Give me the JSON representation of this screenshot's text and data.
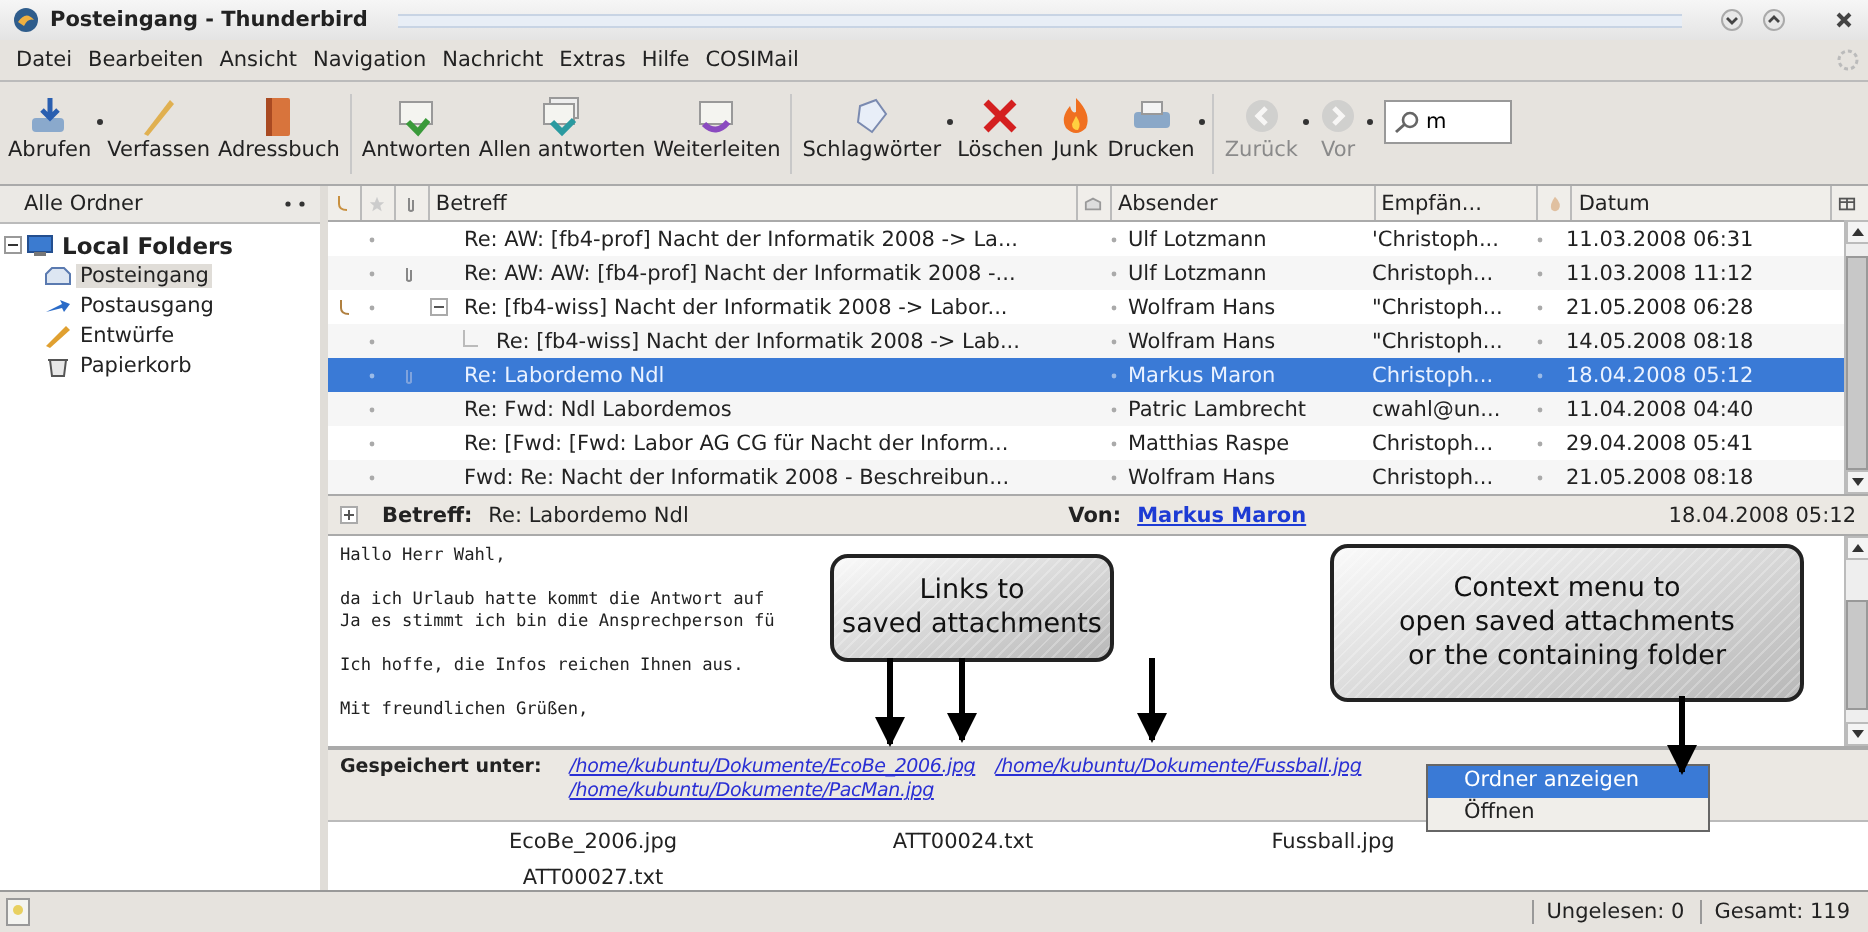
{
  "window": {
    "title": "Posteingang - Thunderbird"
  },
  "menu": [
    {
      "label": "Datei"
    },
    {
      "label": "Bearbeiten"
    },
    {
      "label": "Ansicht"
    },
    {
      "label": "Navigation"
    },
    {
      "label": "Nachricht"
    },
    {
      "label": "Extras"
    },
    {
      "label": "Hilfe"
    },
    {
      "label": "COSIMail"
    }
  ],
  "toolbar": {
    "groups": [
      [
        {
          "label": "Abrufen",
          "kind": "fetch",
          "disabled": false,
          "dropdown": true
        },
        {
          "label": "Verfassen",
          "kind": "compose",
          "disabled": false,
          "dropdown": false
        },
        {
          "label": "Adressbuch",
          "kind": "addressbook",
          "disabled": false,
          "dropdown": false
        }
      ],
      [
        {
          "label": "Antworten",
          "kind": "reply",
          "disabled": false,
          "dropdown": false
        },
        {
          "label": "Allen antworten",
          "kind": "replyall",
          "disabled": false,
          "dropdown": false
        },
        {
          "label": "Weiterleiten",
          "kind": "forward",
          "disabled": false,
          "dropdown": false
        }
      ],
      [
        {
          "label": "Schlagwörter",
          "kind": "tag",
          "disabled": false,
          "dropdown": true
        },
        {
          "label": "Löschen",
          "kind": "delete",
          "disabled": false,
          "dropdown": false
        },
        {
          "label": "Junk",
          "kind": "junk",
          "disabled": false,
          "dropdown": false
        },
        {
          "label": "Drucken",
          "kind": "print",
          "disabled": false,
          "dropdown": true
        }
      ],
      [
        {
          "label": "Zurück",
          "kind": "back",
          "disabled": true,
          "dropdown": true
        },
        {
          "label": "Vor",
          "kind": "next",
          "disabled": true,
          "dropdown": true
        }
      ]
    ],
    "search": {
      "value": "m"
    }
  },
  "folders": {
    "header": "Alle Ordner",
    "items": [
      {
        "label": "Local Folders",
        "kind": "account",
        "selected": false,
        "expanded": true,
        "children": [
          {
            "label": "Posteingang",
            "kind": "inbox",
            "selected": true
          },
          {
            "label": "Postausgang",
            "kind": "outbox",
            "selected": false
          },
          {
            "label": "Entwürfe",
            "kind": "drafts",
            "selected": false
          },
          {
            "label": "Papierkorb",
            "kind": "trash",
            "selected": false
          }
        ]
      }
    ]
  },
  "messages": {
    "columns": {
      "subject": "Betreff",
      "sender": "Absender",
      "recipient": "Empfän...",
      "date": "Datum"
    },
    "rows": [
      {
        "subject": "Re: AW: [fb4-prof] Nacht der Informatik 2008 -> La...",
        "sender": "Ulf Lotzmann",
        "recipient": "'Christoph...",
        "date": "11.03.2008 06:31",
        "attachment": false,
        "thread": false,
        "selected": false
      },
      {
        "subject": "Re: AW: AW: [fb4-prof] Nacht der Informatik 2008 -...",
        "sender": "Ulf Lotzmann",
        "recipient": "Christoph...",
        "date": "11.03.2008 11:12",
        "attachment": true,
        "thread": false,
        "selected": false
      },
      {
        "subject": "Re: [fb4-wiss] Nacht der Informatik 2008 -> Labor...",
        "sender": "Wolfram Hans",
        "recipient": "\"Christoph...",
        "date": "21.05.2008 06:28",
        "attachment": false,
        "thread": true,
        "selected": false,
        "expanded": true,
        "children": [
          {
            "subject": "Re: [fb4-wiss] Nacht der Informatik 2008 -> Lab...",
            "sender": "Wolfram Hans",
            "recipient": "\"Christoph...",
            "date": "14.05.2008 08:18",
            "attachment": false,
            "thread": false,
            "selected": false
          }
        ]
      },
      {
        "subject": "Re: Labordemo Ndl",
        "sender": "Markus Maron",
        "recipient": "Christoph...",
        "date": "18.04.2008 05:12",
        "attachment": true,
        "thread": false,
        "selected": true
      },
      {
        "subject": "Re: Fwd: Ndl Labordemos",
        "sender": "Patric Lambrecht",
        "recipient": "cwahl@un...",
        "date": "11.04.2008 04:40",
        "attachment": false,
        "thread": false,
        "selected": false
      },
      {
        "subject": "Re: [Fwd: [Fwd: Labor AG CG für Nacht der Inform...",
        "sender": "Matthias Raspe",
        "recipient": "Christoph...",
        "date": "29.04.2008 05:41",
        "attachment": false,
        "thread": false,
        "selected": false
      },
      {
        "subject": "Fwd: Re: Nacht der Informatik 2008 - Beschreibun...",
        "sender": "Wolfram Hans",
        "recipient": "Christoph...",
        "date": "21.05.2008 08:18",
        "attachment": false,
        "thread": false,
        "selected": false
      }
    ]
  },
  "message": {
    "subject_label": "Betreff:",
    "subject": "Re: Labordemo Ndl",
    "from_label": "Von:",
    "from": "Markus Maron",
    "date": "18.04.2008 05:12",
    "body": [
      [
        "Hallo Herr Wahl,"
      ],
      [
        "da ich Urlaub hatte kommt die Antwort auf",
        "Ja es stimmt ich bin die Ansprechperson fü"
      ],
      [
        "Ich hoffe, die Infos reichen Ihnen aus."
      ],
      [
        "Mit freundlichen Grüßen,"
      ]
    ],
    "saved_label": "Gespeichert unter:",
    "saved_links": [
      "/home/kubuntu/Dokumente/EcoBe_2006.jpg",
      "/home/kubuntu/Dokumente/Fussball.jpg",
      "/home/kubuntu/Dokumente/PacMan.jpg"
    ],
    "attachments": [
      "EcoBe_2006.jpg",
      "ATT00024.txt",
      "Fussball.jpg",
      "ATT00027.txt"
    ]
  },
  "context_menu": [
    {
      "label": "Ordner anzeigen",
      "selected": true
    },
    {
      "label": "Öffnen",
      "selected": false
    }
  ],
  "callouts": [
    "Links to\nsaved attachments",
    "Context menu to\nopen saved attachments\nor the containing folder"
  ],
  "status_bar": {
    "unread": "Ungelesen: 0",
    "total": "Gesamt: 119"
  }
}
